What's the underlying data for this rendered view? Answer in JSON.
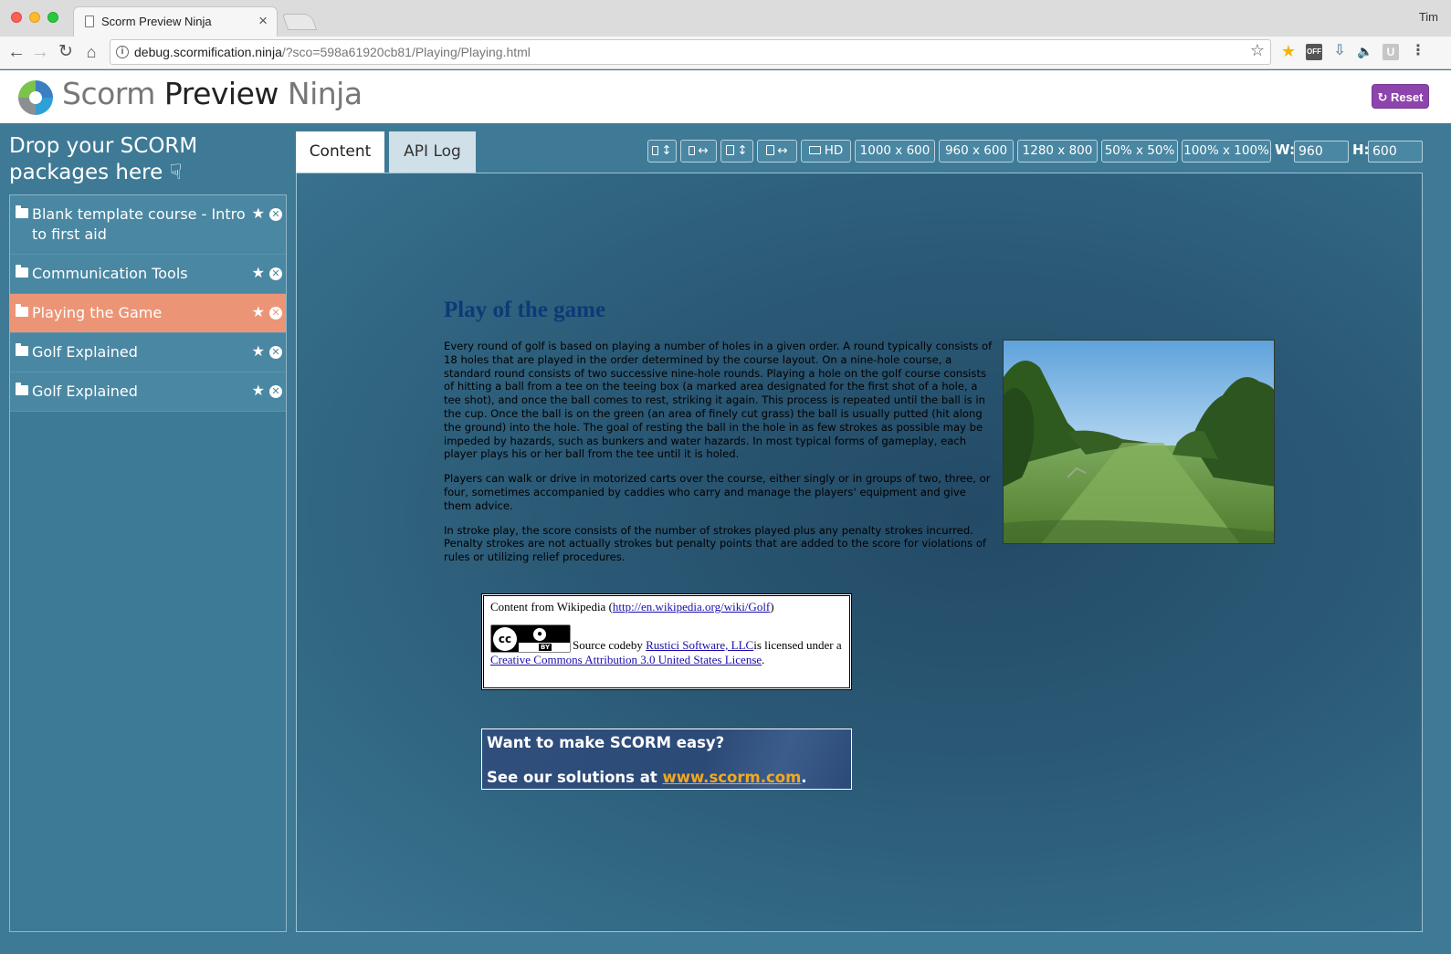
{
  "browser": {
    "tab_title": "Scorm Preview Ninja",
    "tab_close": "×",
    "profile": "Tim",
    "url_host": "debug.scormification.ninja",
    "url_rest": "/?sco=598a61920cb81/Playing/Playing.html",
    "ext_off": "OFF",
    "ext_u": "U"
  },
  "app": {
    "brand_1": "Scorm",
    "brand_2": "Preview",
    "brand_3": "Ninja",
    "reset_label": "Reset"
  },
  "sidebar": {
    "heading": "Drop your SCORM packages here",
    "items": [
      {
        "label": "Blank template course - Intro to first aid",
        "active": false
      },
      {
        "label": "Communication Tools",
        "active": false
      },
      {
        "label": "Playing the Game",
        "active": true
      },
      {
        "label": "Golf Explained",
        "active": false
      },
      {
        "label": "Golf Explained",
        "active": false
      }
    ]
  },
  "tabs": {
    "content": "Content",
    "api_log": "API Log"
  },
  "sizes": {
    "hd": "HD",
    "s1": "1000 x 600",
    "s2": "960 x 600",
    "s3": "1280 x 800",
    "s4": "50% x 50%",
    "s5": "100% x 100%",
    "w_label": "W:",
    "w_value": "960",
    "h_label": "H:",
    "h_value": "600"
  },
  "sco": {
    "title": "Play of the game",
    "p1": "Every round of golf is based on playing a number of holes in a given order. A round typically consists of 18 holes that are played in the order determined by the course layout. On a nine-hole course, a standard round consists of two successive nine-hole rounds. Playing a hole on the golf course consists of hitting a ball from a tee on the teeing box (a marked area designated for the first shot of a hole, a tee shot), and once the ball comes to rest, striking it again. This process is repeated until the ball is in the cup. Once the ball is on the green (an area of finely cut grass) the ball is usually putted (hit along the ground) into the hole. The goal of resting the ball in the hole in as few strokes as possible may be impeded by hazards, such as bunkers and water hazards. In most typical forms of gameplay, each player plays his or her ball from the tee until it is holed.",
    "p2": "Players can walk or drive in motorized carts over the course, either singly or in groups of two, three, or four, sometimes accompanied by caddies who carry and manage the players' equipment and give them advice.",
    "p3": "In stroke play, the score consists of the number of strokes played plus any penalty strokes incurred. Penalty strokes are not actually strokes but penalty points that are added to the score for violations of rules or utilizing relief procedures.",
    "credit_prefix": "Content from Wikipedia (",
    "credit_link": "http://en.wikipedia.org/wiki/Golf",
    "credit_suffix": ")",
    "cc_text": "cc",
    "cc_by": "BY",
    "source_prefix": "Source codeby ",
    "source_link": "Rustici Software, LLC",
    "source_mid": "is licensed under a ",
    "license_link": "Creative Commons Attribution 3.0 United States License",
    "license_end": ".",
    "promo_line1": "Want to make SCORM easy?",
    "promo_prefix": "See our solutions at ",
    "promo_link": "www.scorm.com",
    "promo_end": "."
  },
  "colors": {
    "page_bg": "#3e7a95",
    "active_item": "#ec9576",
    "reset_button": "#8e44ad",
    "sco_title": "#0c3a77",
    "promo_link": "#f4a81c"
  }
}
